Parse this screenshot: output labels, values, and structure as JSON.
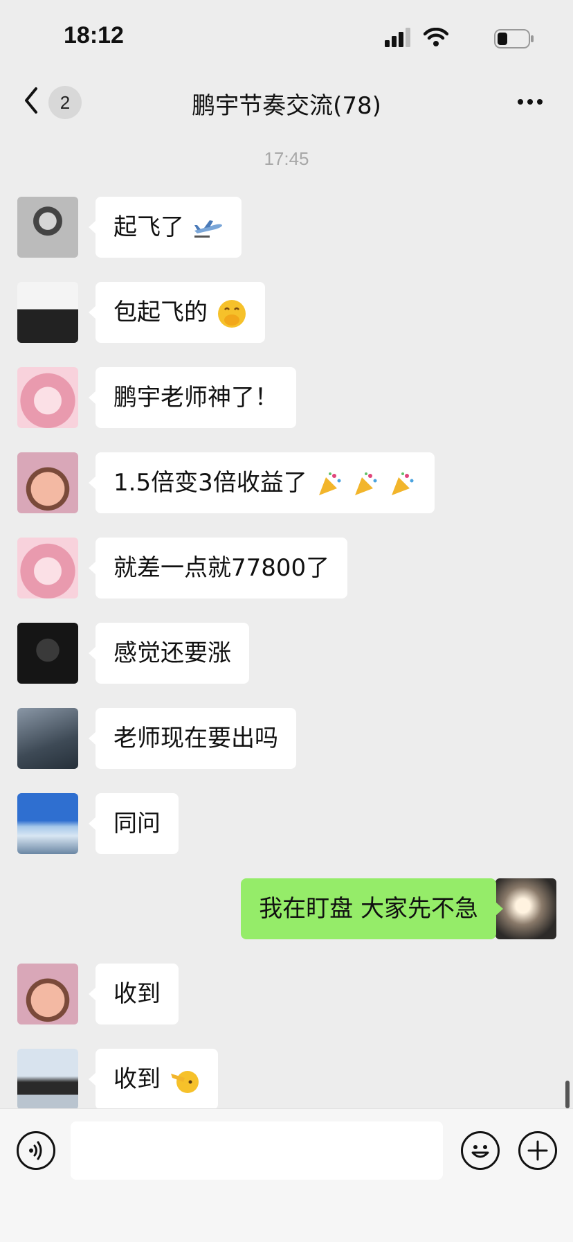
{
  "status_bar": {
    "time": "18:12"
  },
  "nav": {
    "unread_count": "2",
    "title": "鹏宇节奏交流(78)"
  },
  "timestamp": "17:45",
  "messages": [
    {
      "side": "left",
      "text": "起飞了",
      "emoji": "airplane-icon"
    },
    {
      "side": "left",
      "text": "包起飞的",
      "emoji": "hand-over-mouth-icon"
    },
    {
      "side": "left",
      "text": "鹏宇老师神了！",
      "emoji": ""
    },
    {
      "side": "left",
      "text": "1.5倍变3倍收益了",
      "emoji": "party-popper-icon x3"
    },
    {
      "side": "left",
      "text": "就差一点就77800了",
      "emoji": ""
    },
    {
      "side": "left",
      "text": "感觉还要涨",
      "emoji": ""
    },
    {
      "side": "left",
      "text": "老师现在要出吗",
      "emoji": ""
    },
    {
      "side": "left",
      "text": "同问",
      "emoji": ""
    },
    {
      "side": "right",
      "text": "我在盯盘 大家先不急",
      "emoji": ""
    },
    {
      "side": "left",
      "text": "收到",
      "emoji": ""
    },
    {
      "side": "left",
      "text": "收到",
      "emoji": "saluting-face-icon"
    }
  ],
  "input": {
    "value": ""
  },
  "colors": {
    "background": "#ededed",
    "bubble_left": "#ffffff",
    "bubble_right": "#95ec69"
  }
}
